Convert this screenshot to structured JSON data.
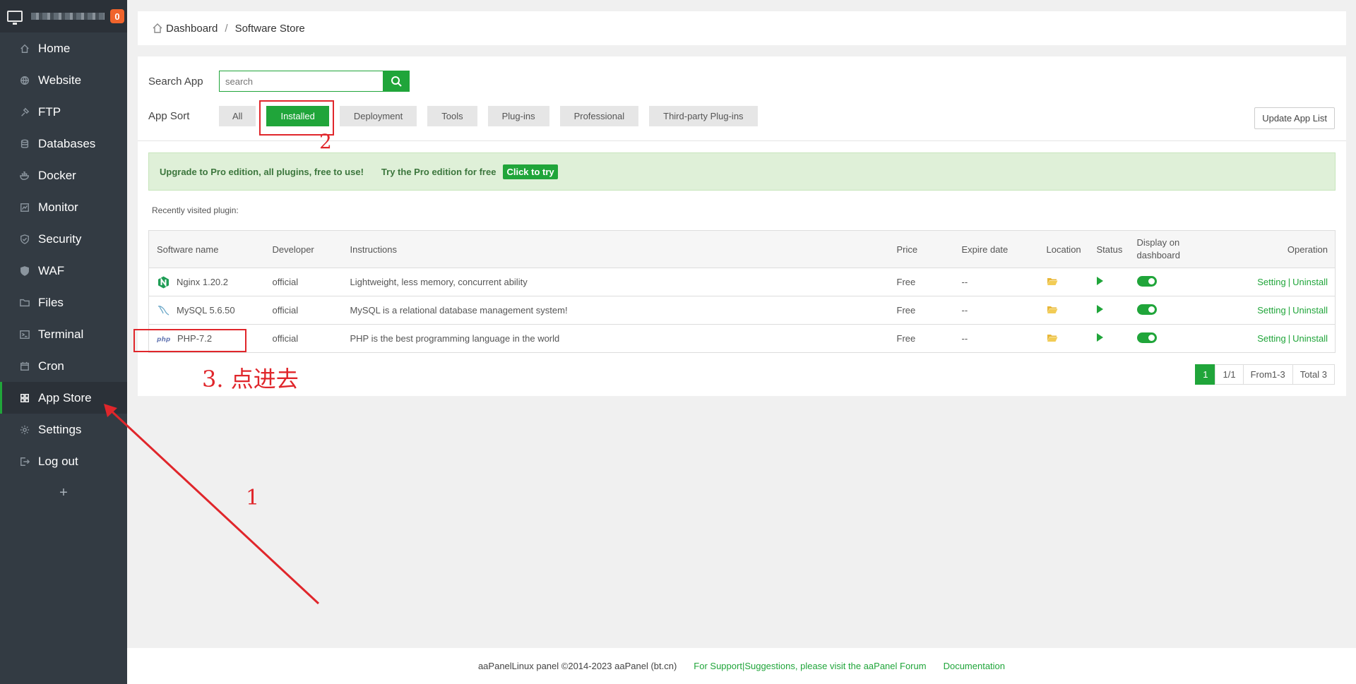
{
  "sidebar": {
    "badge": "0",
    "items": [
      {
        "label": "Home",
        "icon": "home-icon"
      },
      {
        "label": "Website",
        "icon": "globe-icon"
      },
      {
        "label": "FTP",
        "icon": "ftp-icon"
      },
      {
        "label": "Databases",
        "icon": "database-icon"
      },
      {
        "label": "Docker",
        "icon": "docker-icon"
      },
      {
        "label": "Monitor",
        "icon": "monitor-icon"
      },
      {
        "label": "Security",
        "icon": "shield-icon"
      },
      {
        "label": "WAF",
        "icon": "waf-shield-icon"
      },
      {
        "label": "Files",
        "icon": "folder-icon"
      },
      {
        "label": "Terminal",
        "icon": "terminal-icon"
      },
      {
        "label": "Cron",
        "icon": "calendar-icon"
      },
      {
        "label": "App Store",
        "icon": "grid-icon"
      },
      {
        "label": "Settings",
        "icon": "gear-icon"
      },
      {
        "label": "Log out",
        "icon": "logout-icon"
      }
    ],
    "add": "+"
  },
  "breadcrumb": {
    "root": "Dashboard",
    "sep": "/",
    "current": "Software Store"
  },
  "search": {
    "label": "Search App",
    "placeholder": "search"
  },
  "sort": {
    "label": "App Sort",
    "options": [
      "All",
      "Installed",
      "Deployment",
      "Tools",
      "Plug-ins",
      "Professional",
      "Third-party Plug-ins"
    ],
    "active": "Installed"
  },
  "update_button": "Update App List",
  "promo": {
    "text": "Upgrade to Pro edition, all plugins, free to use!",
    "try": "Try the Pro edition for free",
    "button": "Click to try"
  },
  "recent_label": "Recently visited plugin:",
  "table": {
    "headers": [
      "Software name",
      "Developer",
      "Instructions",
      "Price",
      "Expire date",
      "Location",
      "Status",
      "Display on dashboard",
      "Operation"
    ],
    "rows": [
      {
        "name": "Nginx 1.20.2",
        "developer": "official",
        "instructions": "Lightweight, less memory, concurrent ability",
        "price": "Free",
        "expire": "--",
        "setting": "Setting",
        "sep": "|",
        "uninstall": "Uninstall"
      },
      {
        "name": "MySQL 5.6.50",
        "developer": "official",
        "instructions": "MySQL is a relational database management system!",
        "price": "Free",
        "expire": "--",
        "setting": "Setting",
        "sep": "|",
        "uninstall": "Uninstall"
      },
      {
        "name": "PHP-7.2",
        "developer": "official",
        "instructions": "PHP is the best programming language in the world",
        "price": "Free",
        "expire": "--",
        "setting": "Setting",
        "sep": "|",
        "uninstall": "Uninstall"
      }
    ]
  },
  "pager": {
    "current": "1",
    "pages": "1/1",
    "range": "From1-3",
    "total": "Total 3"
  },
  "footer": {
    "copyright": "aaPanelLinux panel ©2014-2023 aaPanel (bt.cn)",
    "support": "For Support|Suggestions, please visit the aaPanel Forum",
    "docs": "Documentation"
  },
  "annotations": {
    "step1": "1",
    "step2": "2",
    "step3": "3. 点进去",
    "color": "#e0262b"
  },
  "colors": {
    "accent": "#20a53a",
    "sidebar": "#333b43",
    "badge": "#f0642c"
  }
}
